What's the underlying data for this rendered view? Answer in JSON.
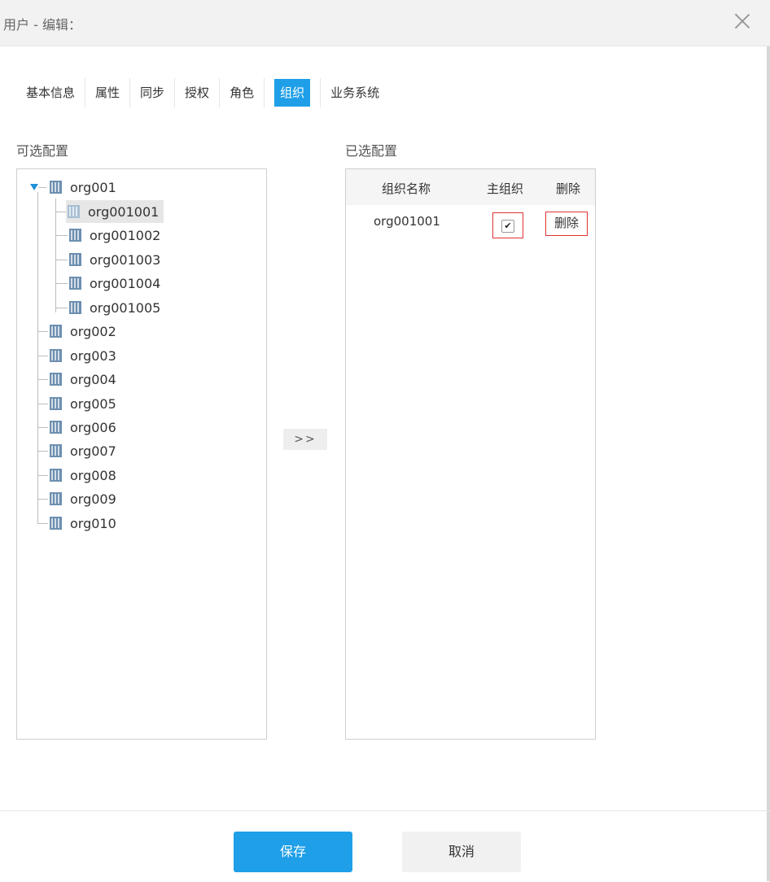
{
  "dialog": {
    "title": "用户 - 编辑：",
    "close_icon": "close-icon"
  },
  "tabs": [
    {
      "label": "基本信息"
    },
    {
      "label": "属性"
    },
    {
      "label": "同步"
    },
    {
      "label": "授权"
    },
    {
      "label": "角色"
    },
    {
      "label": "组织",
      "active": true
    },
    {
      "label": "业务系统"
    }
  ],
  "available": {
    "label": "可选配置",
    "tree": [
      {
        "label": "org001",
        "expanded": true
      },
      {
        "label": "org001001",
        "selected": true
      },
      {
        "label": "org001002"
      },
      {
        "label": "org001003"
      },
      {
        "label": "org001004"
      },
      {
        "label": "org001005"
      },
      {
        "label": "org002"
      },
      {
        "label": "org003"
      },
      {
        "label": "org004"
      },
      {
        "label": "org005"
      },
      {
        "label": "org006"
      },
      {
        "label": "org007"
      },
      {
        "label": "org008"
      },
      {
        "label": "org009"
      },
      {
        "label": "org010"
      }
    ]
  },
  "move_button": ">>",
  "selected": {
    "label": "已选配置",
    "columns": [
      "组织名称",
      "主组织",
      "删除"
    ],
    "rows": [
      {
        "name": "org001001",
        "primary_checked": "✔",
        "delete": "删除"
      }
    ]
  },
  "footer": {
    "save": "保存",
    "cancel": "取消"
  },
  "colors": {
    "accent": "#1e9fe8",
    "highlight_border": "#dd3333"
  }
}
